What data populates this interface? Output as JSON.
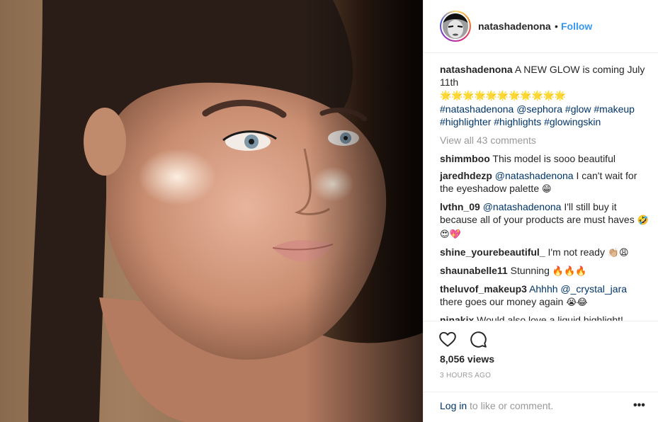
{
  "post": {
    "username": "natashadenona",
    "separator": "•",
    "follow_label": "Follow",
    "caption": {
      "user": "natashadenona",
      "text": "A NEW GLOW is coming July 11th",
      "emojis": "🌟🌟🌟🌟🌟🌟🌟🌟🌟🌟🌟",
      "hashtags": "#natashadenona @sephora #glow #makeup #highlighter #highlights #glowingskin"
    },
    "view_all": "View all 43 comments",
    "comments": [
      {
        "user": "shimmboo",
        "mention": "",
        "text": "This model is sooo beautiful",
        "emoji": ""
      },
      {
        "user": "jaredhdezp",
        "mention": "@natashadenona",
        "text": "I can't wait for the eyeshadow palette",
        "emoji": "😁"
      },
      {
        "user": "lvthn_09",
        "mention": "@natashadenona",
        "text": "I'll still buy it because all of your products are must haves",
        "emoji": "🤣😍💖"
      },
      {
        "user": "shine_yourebeautiful_",
        "mention": "",
        "text": "I'm not ready",
        "emoji": "👏🏼😩"
      },
      {
        "user": "shaunabelle11",
        "mention": "",
        "text": "Stunning",
        "emoji": "🔥🔥🔥"
      },
      {
        "user": "theluvof_makeup3",
        "mention": "Ahhhh @_crystal_jara",
        "text": "there goes our money again",
        "emoji": "😭😂"
      },
      {
        "user": "ninakix",
        "mention": "",
        "text": "Would also love a liquid highlight! Especially one with an unusual reflect that",
        "emoji": ""
      }
    ],
    "views": "8,056 views",
    "time": "3 HOURS AGO",
    "login_link": "Log in",
    "login_rest": "to like or comment.",
    "more_label": "•••"
  },
  "icons": {
    "heart": "heart-icon",
    "comment": "comment-icon",
    "more": "more-options-icon"
  },
  "colors": {
    "link_blue": "#3897f0",
    "hashtag_blue": "#003569",
    "muted": "#999999",
    "text": "#262626"
  }
}
